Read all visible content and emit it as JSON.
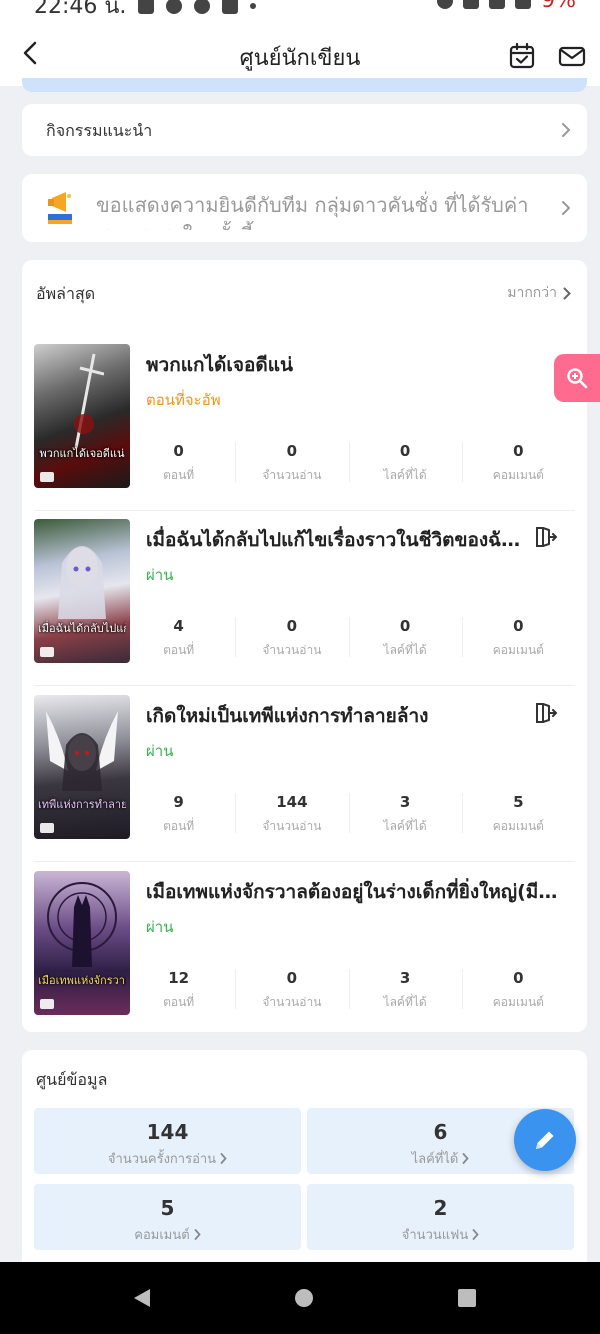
{
  "status_bar": {
    "time": "22:46 น.",
    "battery": "9%"
  },
  "header": {
    "title": "ศูนย์นักเขียน"
  },
  "activity": {
    "label": "กิจกรรมแนะนำ"
  },
  "announcement": {
    "text": "ขอแสดงความยินดีกับทีม กลุ่มดาวคันชั่ง ที่ได้รับค่าสนุนสูงสุดในครั้งนี้"
  },
  "latest": {
    "title": "อัพล่าสุด",
    "more": "มากกว่า",
    "stat_labels": {
      "episodes": "ตอนที่",
      "reads": "จำนวนอ่าน",
      "likes": "ไลค์ที่ได้",
      "comments": "คอมเมนต์"
    },
    "books": [
      {
        "title": "พวกแกได้เจอดีแน่",
        "status": "ตอนที่จะอัพ",
        "cover_text": "พวกแกได้เจอดีแน่",
        "episodes": "0",
        "reads": "0",
        "likes": "0",
        "comments": "0"
      },
      {
        "title": "เมื่อฉันได้กลับไปแก้ไขเรื่องราวในชีวิตของฉันด้วยโลกเวทมนตร์",
        "status": "ผ่าน",
        "cover_text": "เมื่อฉันได้กลับไปแก้ไข",
        "episodes": "4",
        "reads": "0",
        "likes": "0",
        "comments": "0"
      },
      {
        "title": "เกิดใหม่เป็นเทพีแห่งการทำลายล้าง",
        "status": "ผ่าน",
        "cover_text": "เทพีแห่งการทำลายล้าง",
        "episodes": "9",
        "reads": "144",
        "likes": "3",
        "comments": "5"
      },
      {
        "title": "เมือเทพแห่งจักรวาลต้องอยู่ในร่างเด็กที่ยิ่งใหญ่(มีคำหยาบ)",
        "status": "ผ่าน",
        "cover_text": "เมือเทพแห่งจักรวาล",
        "episodes": "12",
        "reads": "0",
        "likes": "3",
        "comments": "0"
      }
    ]
  },
  "info": {
    "title": "ศูนย์ข้อมูล",
    "items": [
      {
        "value": "144",
        "label": "จำนวนครั้งการอ่าน"
      },
      {
        "value": "6",
        "label": "ไลค์ที่ได้"
      },
      {
        "value": "5",
        "label": "คอมเมนต์"
      },
      {
        "value": "2",
        "label": "จำนวนแฟน"
      }
    ]
  },
  "colors": {
    "accent_blue": "#3a93ee",
    "pink": "#ff6a8e",
    "status_orange": "#f0931b",
    "status_green": "#38b24a"
  },
  "icons": {
    "back": "chevron-left-icon",
    "calendar": "calendar-check-icon",
    "mail": "mail-icon",
    "edit": "pencil-icon",
    "search": "zoom-in-icon",
    "exit": "exit-icon"
  }
}
